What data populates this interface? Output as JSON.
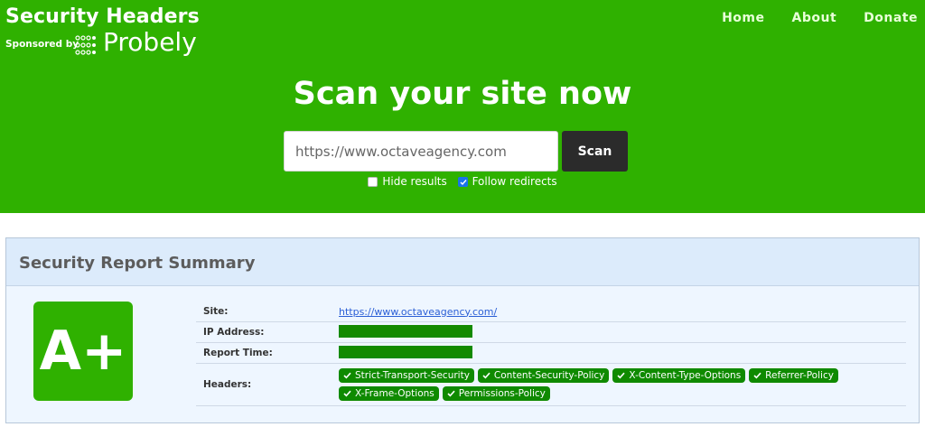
{
  "header": {
    "title": "Security Headers",
    "sponsored_by": "Sponsored by",
    "sponsor_name": "Probely",
    "nav": [
      "Home",
      "About",
      "Donate"
    ],
    "headline": "Scan your site now"
  },
  "scan": {
    "input_value": "https://www.octaveagency.com",
    "button_label": "Scan",
    "options": [
      {
        "label": "Hide results",
        "checked": false
      },
      {
        "label": "Follow redirects",
        "checked": true
      }
    ]
  },
  "report": {
    "title": "Security Report Summary",
    "grade": "A+",
    "labels": {
      "site": "Site:",
      "ip": "IP Address:",
      "time": "Report Time:",
      "headers": "Headers:"
    },
    "site_url": "https://www.octaveagency.com/",
    "headers": [
      "Strict-Transport-Security",
      "Content-Security-Policy",
      "X-Content-Type-Options",
      "Referrer-Policy",
      "X-Frame-Options",
      "Permissions-Policy"
    ]
  },
  "colors": {
    "brand_green": "#2fb100",
    "chip_green": "#0f8a00",
    "scan_button": "#2b2b2b",
    "panel_bg": "#eef6ff"
  }
}
